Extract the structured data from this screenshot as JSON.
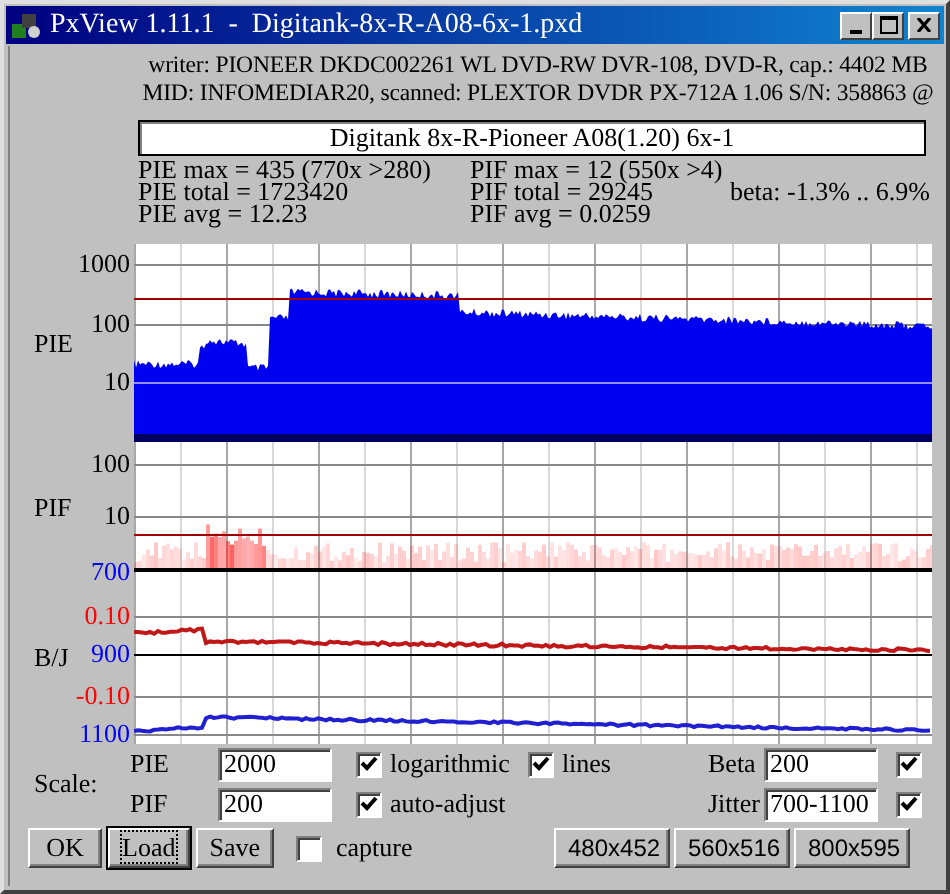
{
  "window": {
    "title": "PxView 1.11.1  -  Digitank-8x-R-A08-6x-1.pxd"
  },
  "header": {
    "lines": [
      "writer: PIONEER DKDC002261 WL DVD-RW DVR-108, DVD-R, cap.: 4402 MB",
      "MID: INFOMEDIAR20, scanned: PLEXTOR DVDR PX-712A 1.06 S/N: 358863 @"
    ],
    "disc_title": "Digitank 8x-R-Pioneer A08(1.20) 6x-1"
  },
  "stats": {
    "pie": [
      "PIE max = 435 (770x >280)",
      "PIE total = 1723420",
      "PIE avg = 12.23"
    ],
    "pif": [
      "PIF max = 12 (550x >4)",
      "PIF total = 29245",
      "PIF avg = 0.0259"
    ],
    "beta": "beta: -1.3% .. 6.9%"
  },
  "graph": {
    "sections": [
      {
        "kind": "pie",
        "label": "PIE",
        "ticks": [
          {
            "text": "1000",
            "color": "#000000"
          },
          {
            "text": "100",
            "color": "#000000"
          },
          {
            "text": "10",
            "color": "#000000"
          }
        ]
      },
      {
        "kind": "pif",
        "label": "PIF",
        "ticks": [
          {
            "text": "100",
            "color": "#000000"
          },
          {
            "text": "10",
            "color": "#000000"
          }
        ]
      },
      {
        "kind": "bj",
        "label": "B/J",
        "ticks": [
          {
            "text": "700",
            "color": "#0000ff"
          },
          {
            "text": "0.10",
            "color": "#ff0000"
          },
          {
            "text": "900",
            "color": "#0000ff"
          },
          {
            "text": "-0.10",
            "color": "#ff0000"
          },
          {
            "text": "1100",
            "color": "#0000ff"
          }
        ]
      }
    ]
  },
  "scale": {
    "label": "Scale:",
    "rows": [
      {
        "label": "PIE",
        "value": "2000"
      },
      {
        "label": "PIF",
        "value": "200"
      }
    ],
    "options": [
      {
        "label": "logarithmic",
        "checked": true
      },
      {
        "label": "lines",
        "checked": true
      },
      {
        "label": "auto-adjust",
        "checked": true
      }
    ],
    "beta": {
      "label": "Beta",
      "value": "200",
      "checked": true
    },
    "jitter": {
      "label": "Jitter",
      "value": "700-1100",
      "checked": true
    }
  },
  "buttons": [
    {
      "label": "OK",
      "focused": false
    },
    {
      "label": "Load",
      "focused": true
    },
    {
      "label": "Save",
      "focused": false
    }
  ],
  "capture": {
    "label": "capture",
    "checked": false
  },
  "size_buttons": [
    "480x452",
    "560x516",
    "800x595"
  ]
}
